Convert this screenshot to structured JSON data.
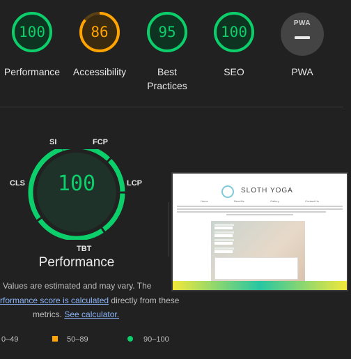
{
  "colors": {
    "pass": "#0cce6b",
    "average": "#ffa400",
    "fail": "#ff4e42",
    "pwa": "#444444"
  },
  "categories": [
    {
      "label": "Performance",
      "score": 100,
      "state": "pass"
    },
    {
      "label": "Accessibility",
      "score": 86,
      "state": "average"
    },
    {
      "label": "Best Practices",
      "line1": "Best",
      "line2": "Practices",
      "score": 95,
      "state": "pass"
    },
    {
      "label": "SEO",
      "score": 100,
      "state": "pass"
    },
    {
      "label": "PWA",
      "badge": "PWA"
    }
  ],
  "performance": {
    "score": 100,
    "title": "Performance",
    "metrics": [
      "SI",
      "FCP",
      "LCP",
      "TBT",
      "CLS"
    ],
    "note_part1": "Values are estimated and may vary. The",
    "note_link1": "rformance score is calculated",
    "note_part2": " directly from these",
    "note_part3": "metrics. ",
    "note_link2": "See calculator."
  },
  "legend": [
    {
      "range": "0–49",
      "state": "fail"
    },
    {
      "range": "50–89",
      "state": "average"
    },
    {
      "range": "90–100",
      "state": "pass"
    }
  ],
  "screenshot": {
    "brand": "SLOTH YOGA",
    "nav": [
      "Home",
      "Benefits",
      "Gallery",
      "Contact Us"
    ]
  }
}
